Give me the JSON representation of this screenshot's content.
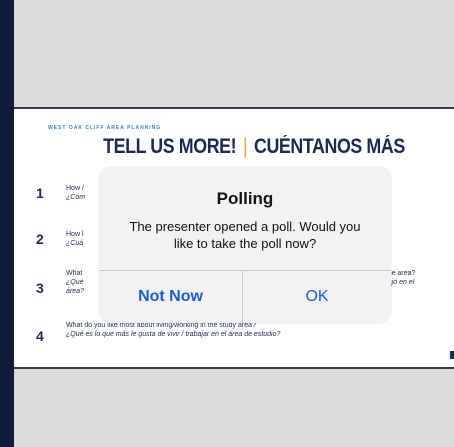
{
  "slide": {
    "kicker": "WEST OAK CLIFF AREA PLANNING",
    "title_en": "TELL US MORE!",
    "separator": "|",
    "title_es": "CUÉNTANOS MÁS",
    "questions": [
      {
        "number": "1",
        "en": "How /",
        "es": "¿Cóm"
      },
      {
        "number": "2",
        "en": "How l",
        "es": "¿Cuá"
      },
      {
        "number": "3",
        "en": "What",
        "es": "¿Qué",
        "es2": "área?",
        "tail_en": "n the area?",
        "tail_es": "abajó en el"
      },
      {
        "number": "4",
        "en": "What do you like most about living/working in the study area?",
        "es": "¿Qué es lo que más le gusta de vivir / trabajar en el área de estudio?"
      }
    ]
  },
  "dialog": {
    "title": "Polling",
    "message": "The presenter opened a poll. Would you like to take the poll now?",
    "not_now_label": "Not Now",
    "ok_label": "OK"
  }
}
